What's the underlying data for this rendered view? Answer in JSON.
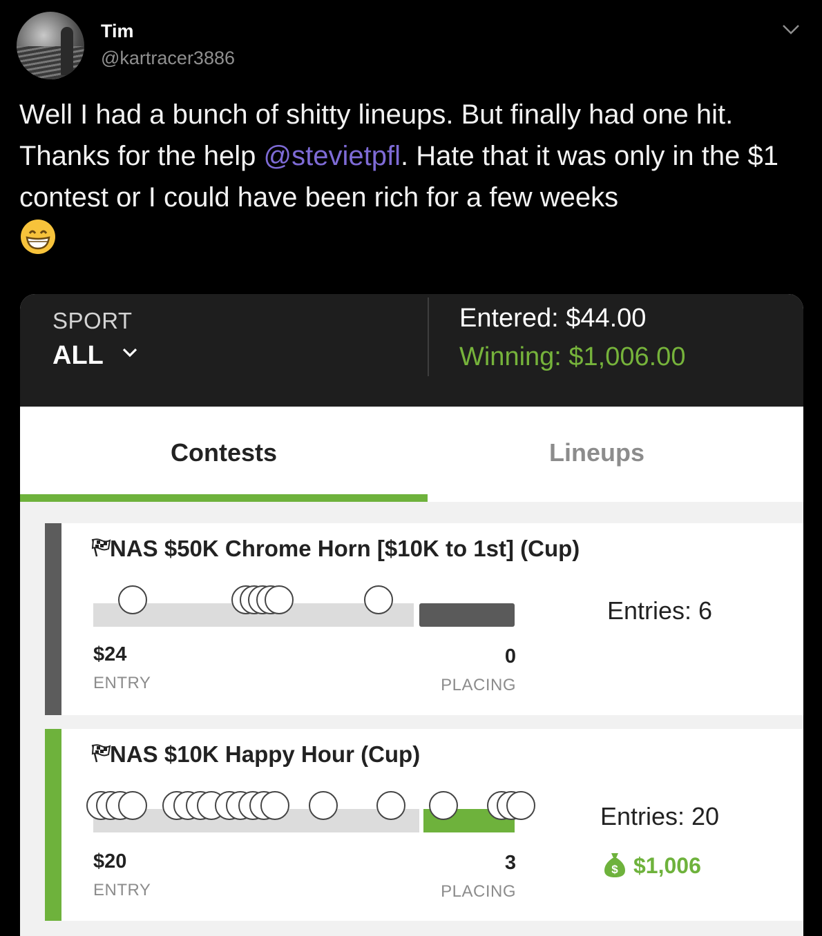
{
  "tweet": {
    "author_name": "Tim",
    "author_handle": "@kartracer3886",
    "text_part1": "Well I had a bunch of shitty lineups. But finally had one hit. Thanks for the help ",
    "mention": "@stevietpfl",
    "text_part2": ". Hate that it was only in the $1 contest or I could have been rich for a few weeks",
    "emoji": "grinning-face-with-smiling-eyes"
  },
  "app": {
    "sport": {
      "label": "SPORT",
      "value": "ALL"
    },
    "entered": "Entered: $44.00",
    "winning": "Winning: $1,006.00",
    "tabs": [
      {
        "label": "Contests",
        "active": true
      },
      {
        "label": "Lineups",
        "active": false
      }
    ],
    "accent_color": "#6eb23c",
    "contests": [
      {
        "title": "NAS $50K Chrome Horn [$10K to 1st] (Cup)",
        "entry_amount": "$24",
        "entry_label": "ENTRY",
        "placing_value": "0",
        "placing_label": "PLACING",
        "entries": "Entries: 6",
        "status_color": "#5c5c5c"
      },
      {
        "title": "NAS $10K Happy Hour (Cup)",
        "entry_amount": "$20",
        "entry_label": "ENTRY",
        "placing_value": "3",
        "placing_label": "PLACING",
        "entries": "Entries: 20",
        "winnings": "$1,006",
        "status_color": "#6eb23c"
      }
    ]
  }
}
